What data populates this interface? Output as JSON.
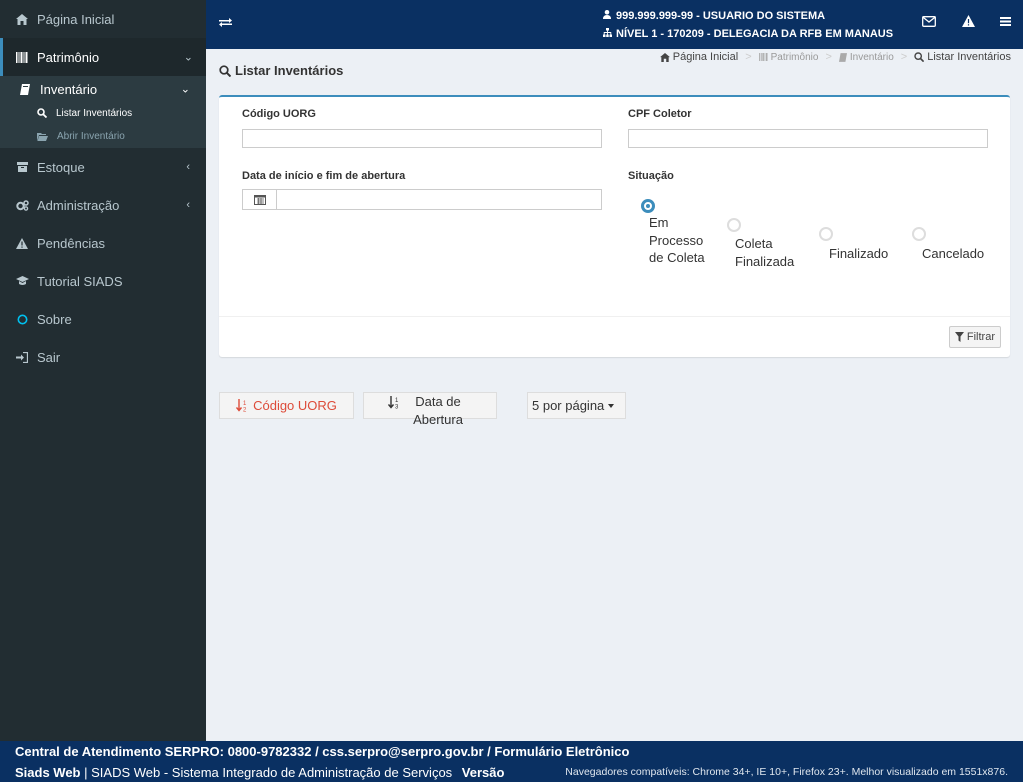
{
  "sidebar": {
    "items": [
      {
        "label": "Página Inicial",
        "icon": "home-icon"
      },
      {
        "label": "Patrimônio",
        "icon": "barcode-icon"
      },
      {
        "label": "Inventário",
        "icon": "book-icon"
      },
      {
        "label": "Listar Inventários",
        "icon": "search-icon"
      },
      {
        "label": "Abrir Inventário",
        "icon": "folder-open-icon"
      },
      {
        "label": "Estoque",
        "icon": "archive-icon"
      },
      {
        "label": "Administração",
        "icon": "cogs-icon"
      },
      {
        "label": "Pendências",
        "icon": "warning-icon"
      },
      {
        "label": "Tutorial SIADS",
        "icon": "graduation-cap-icon"
      },
      {
        "label": "Sobre",
        "icon": "circle-icon"
      },
      {
        "label": "Sair",
        "icon": "sign-in-icon"
      }
    ]
  },
  "header": {
    "user_line": "999.999.999-99 - USUARIO DO SISTEMA",
    "unit_line": "NÍVEL 1 - 170209 - DELEGACIA DA RFB EM MANAUS"
  },
  "content": {
    "title": "Listar Inventários",
    "breadcrumb": [
      "Página Inicial",
      "Patrimônio",
      "Inventário",
      "Listar Inventários"
    ],
    "form": {
      "codigo_uorg_label": "Código UORG",
      "codigo_uorg_value": "",
      "cpf_coletor_label": "CPF Coletor",
      "cpf_coletor_value": "",
      "data_label": "Data de início e fim de abertura",
      "data_value": "",
      "situacao_label": "Situação",
      "situacao_options": [
        {
          "label": "Em Processo de Coleta",
          "selected": true
        },
        {
          "label": "Coleta Finalizada",
          "selected": false
        },
        {
          "label": "Finalizado",
          "selected": false
        },
        {
          "label": "Cancelado",
          "selected": false
        }
      ],
      "filter_button": "Filtrar"
    },
    "sort_buttons": [
      "Código UORG",
      "Data de Abertura"
    ],
    "per_page": "5 por página"
  },
  "footer": {
    "line1": "Central de Atendimento SERPRO: 0800-9782332 / css.serpro@serpro.gov.br / Formulário Eletrônico",
    "brand": "Siads Web",
    "line2": "| SIADS Web - Sistema Integrado de Administração de Serviços",
    "version_label": "Versão",
    "browsers": "Navegadores compatíveis: Chrome 34+, IE 10+, Firefox 23+. Melhor visualizado em 1551x876."
  },
  "colors": {
    "navy": "#0a3062",
    "sidebar": "#222d32",
    "accent": "#3c8dbc",
    "sort_active": "#dd4b39"
  }
}
